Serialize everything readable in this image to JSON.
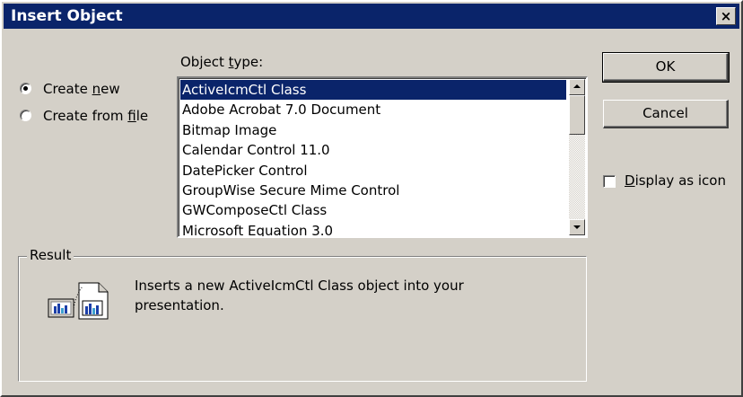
{
  "window": {
    "title": "Insert Object",
    "close_glyph": "×"
  },
  "source_options": {
    "create_new": {
      "pre": "Create ",
      "key": "n",
      "post": "ew",
      "selected": true
    },
    "create_from_file": {
      "pre": "Create from ",
      "key": "f",
      "post": "ile",
      "selected": false
    }
  },
  "object_type": {
    "label_pre": "Object ",
    "label_key": "t",
    "label_post": "ype:",
    "items": [
      "ActiveIcmCtl Class",
      "Adobe Acrobat 7.0 Document",
      "Bitmap Image",
      "Calendar Control 11.0",
      "DatePicker Control",
      "GroupWise Secure Mime Control",
      "GWComposeCtl Class",
      "Microsoft Equation 3.0"
    ],
    "selected_index": 0
  },
  "buttons": {
    "ok": "OK",
    "cancel": "Cancel"
  },
  "display_as_icon": {
    "key": "D",
    "rest": "isplay as icon",
    "checked": false
  },
  "result": {
    "label": "Result",
    "line1": "Inserts a new ActiveIcmCtl Class object into your",
    "line2": "presentation.",
    "icon": "insert-object-icon"
  },
  "colors": {
    "titlebar": "#0a246a",
    "face": "#d4d0c8",
    "selection": "#0a246a"
  }
}
